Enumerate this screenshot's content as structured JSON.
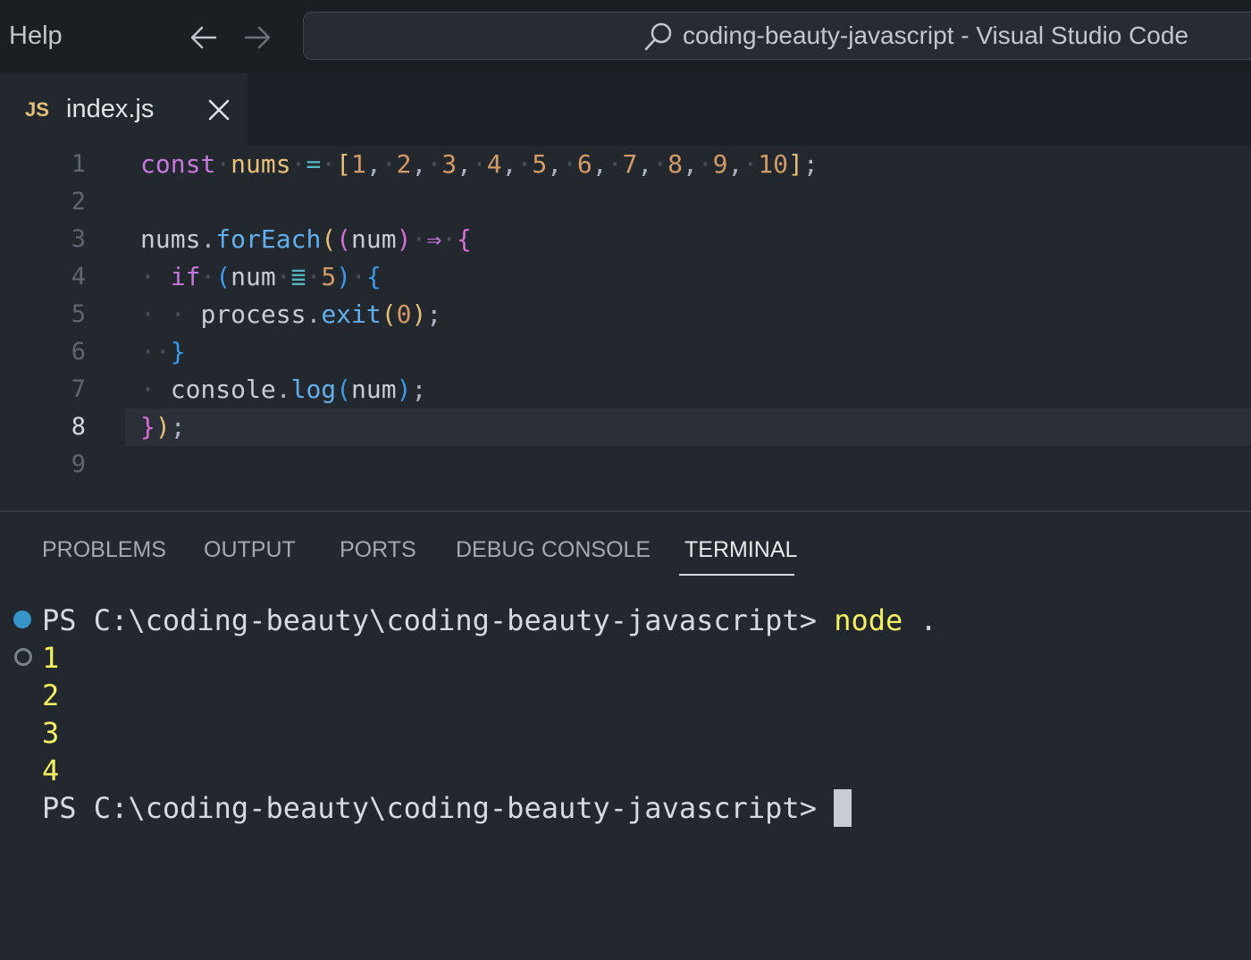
{
  "titlebar": {
    "menu_help": "Help",
    "window_title": "coding-beauty-javascript - Visual Studio Code"
  },
  "tab": {
    "file_icon": "JS",
    "file_name": "index.js"
  },
  "editor": {
    "line_numbers": [
      "1",
      "2",
      "3",
      "4",
      "5",
      "6",
      "7",
      "8",
      "9"
    ],
    "active_line": 8
  },
  "panel": {
    "tabs": [
      "PROBLEMS",
      "OUTPUT",
      "PORTS",
      "DEBUG CONSOLE",
      "TERMINAL"
    ],
    "active_tab": "TERMINAL"
  },
  "terminal": {
    "prompt": "PS C:\\coding-beauty\\coding-beauty-javascript>",
    "command": "node",
    "command_arg": ".",
    "output": [
      "1",
      "2",
      "3",
      "4"
    ]
  },
  "colors": {
    "keyword": "#c678dd",
    "variable": "#e5c07b",
    "number": "#d19a66",
    "function": "#61afef",
    "terminal_yellow": "#f3f062",
    "run_dot": "#3794c8"
  }
}
